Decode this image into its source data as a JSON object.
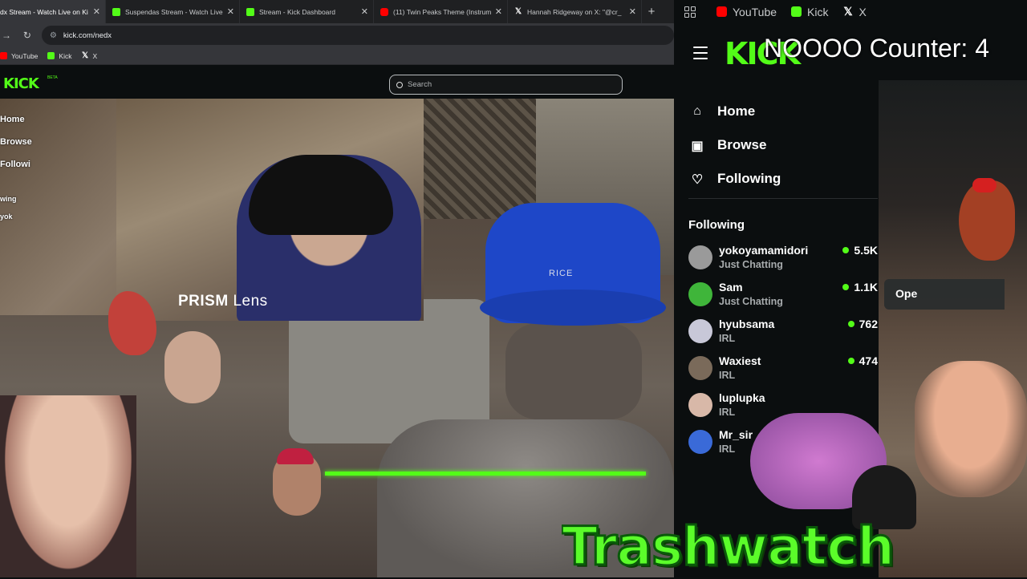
{
  "browser": {
    "tabs": [
      {
        "title": "dx Stream - Watch Live on Ki",
        "icon": "kick",
        "active": true
      },
      {
        "title": "Suspendas Stream - Watch Live",
        "icon": "kick"
      },
      {
        "title": "Stream - Kick Dashboard",
        "icon": "kick"
      },
      {
        "title": "(11) Twin Peaks Theme (Instrum",
        "icon": "youtube"
      },
      {
        "title": "Hannah Ridgeway on X: \"@cr_",
        "icon": "x"
      }
    ],
    "url": "kick.com/nedx",
    "bookmarks": [
      "YouTube",
      "Kick",
      "X"
    ]
  },
  "kick_page": {
    "logo": "KICK",
    "logo_badge": "BETA",
    "search_placeholder": "Search",
    "nav": [
      "Home",
      "Browse",
      "Followi",
      "",
      "wing",
      "yok"
    ]
  },
  "stream": {
    "prism_label_bold": "PRISM",
    "prism_label_rest": " Lens",
    "hat_text": "RICE",
    "banner": "Trashwatch"
  },
  "right_panel": {
    "bookmarks": [
      "YouTube",
      "Kick",
      "X"
    ],
    "logo": "KICK",
    "counter": "NOOOO Counter: 4",
    "nav": [
      {
        "label": "Home",
        "icon": "home-icon"
      },
      {
        "label": "Browse",
        "icon": "browse-icon"
      },
      {
        "label": "Following",
        "icon": "heart-icon"
      }
    ],
    "following_title": "Following",
    "following": [
      {
        "name": "yokoyamamidori",
        "category": "Just Chatting",
        "viewers": "5.5K",
        "avatar_color": "#9a9a9a"
      },
      {
        "name": "Sam",
        "category": "Just Chatting",
        "viewers": "1.1K",
        "avatar_color": "#3fb53a"
      },
      {
        "name": "hyubsama",
        "category": "IRL",
        "viewers": "762",
        "avatar_color": "#c8c8d8"
      },
      {
        "name": "Waxiest",
        "category": "IRL",
        "viewers": "474",
        "avatar_color": "#7a6a5a"
      },
      {
        "name": "luplupka",
        "category": "IRL",
        "viewers": "",
        "avatar_color": "#d8b8a8"
      },
      {
        "name": "Mr_sir",
        "category": "IRL",
        "viewers": "",
        "avatar_color": "#3a6ad8"
      }
    ],
    "open_chip": "Ope"
  }
}
